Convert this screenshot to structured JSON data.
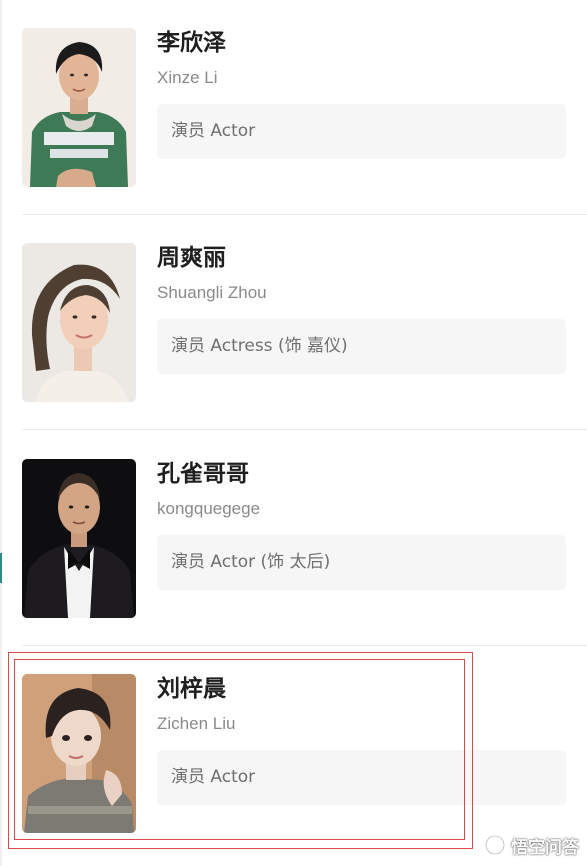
{
  "cast": [
    {
      "name": "李欣泽",
      "romanized": "Xinze Li",
      "role": "演员 Actor"
    },
    {
      "name": "周爽丽",
      "romanized": "Shuangli Zhou",
      "role": "演员 Actress (饰 嘉仪)"
    },
    {
      "name": "孔雀哥哥",
      "romanized": "kongquegege",
      "role": "演员 Actor (饰 太后)"
    },
    {
      "name": "刘梓晨",
      "romanized": "Zichen Liu",
      "role": "演员 Actor"
    }
  ],
  "watermark": {
    "text": "悟空问答",
    "icon": "wukong-logo-icon"
  },
  "colors": {
    "highlight": "#d94b4b",
    "role_box_bg": "#f6f6f6",
    "secondary_text": "#8a8a8a"
  }
}
